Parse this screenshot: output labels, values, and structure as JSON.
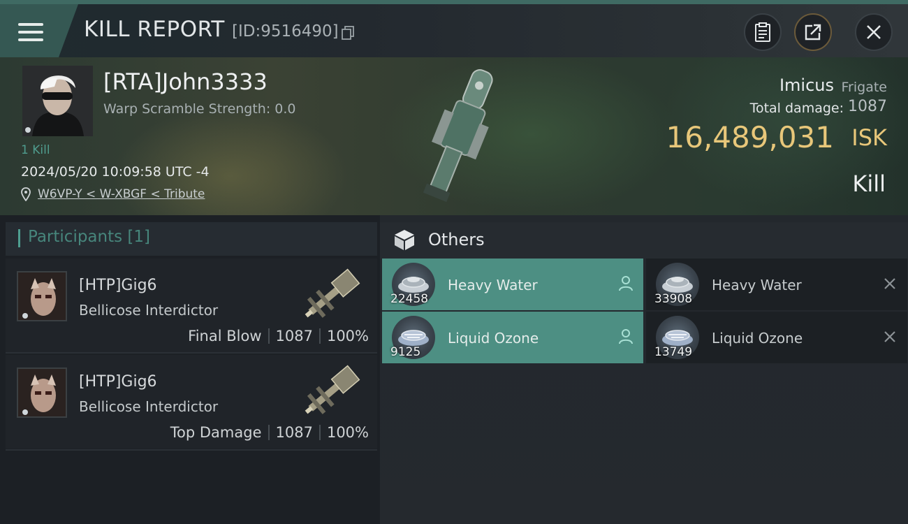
{
  "header": {
    "title": "KILL REPORT",
    "id_text": "[ID:9516490]"
  },
  "victim": {
    "name": "[RTA]John3333",
    "warp_scramble": "Warp Scramble Strength: 0.0",
    "kills": "1 Kill",
    "datetime": "2024/05/20 10:09:58 UTC -4",
    "location": "W6VP-Y < W-XBGF < Tribute",
    "ship_name": "Imicus",
    "ship_class": "Frigate",
    "total_damage_label": "Total damage:",
    "total_damage": "1087",
    "isk_value": "16,489,031",
    "isk_unit": "ISK",
    "result": "Kill"
  },
  "participants": {
    "title": "Participants [1]",
    "rows": [
      {
        "name": "[HTP]Gig6",
        "ship": "Bellicose Interdictor",
        "role": "Final Blow",
        "damage": "1087",
        "percent": "100%"
      },
      {
        "name": "[HTP]Gig6",
        "ship": "Bellicose Interdictor",
        "role": "Top Damage",
        "damage": "1087",
        "percent": "100%"
      }
    ]
  },
  "others": {
    "title": "Others",
    "items": [
      {
        "name": "Heavy Water",
        "qty": "22458",
        "status": "dropped",
        "flag_icon": "person-icon"
      },
      {
        "name": "Heavy Water",
        "qty": "33908",
        "status": "destroyed",
        "flag_icon": "close-icon"
      },
      {
        "name": "Liquid Ozone",
        "qty": "9125",
        "status": "dropped",
        "flag_icon": "person-icon"
      },
      {
        "name": "Liquid Ozone",
        "qty": "13749",
        "status": "destroyed",
        "flag_icon": "close-icon"
      }
    ]
  },
  "colors": {
    "accent_teal": "#4d8f83",
    "isk_gold": "#e8c77a"
  }
}
